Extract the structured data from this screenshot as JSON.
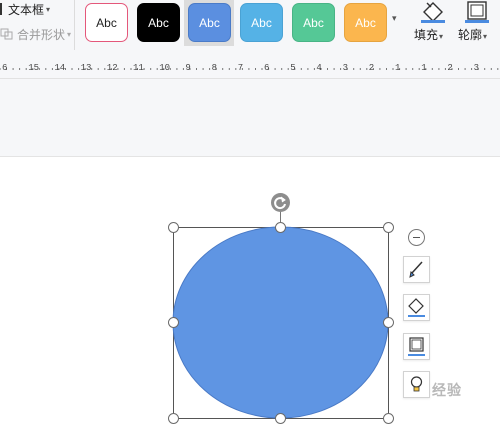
{
  "ribbon": {
    "text_box_label": "文本框",
    "merge_shapes_label": "合并形状",
    "dropdown_caret": "▾",
    "style_presets": [
      {
        "label": "Abc",
        "fill": "#ffffff",
        "border": "#e4577a",
        "text_color": "#222222"
      },
      {
        "label": "Abc",
        "fill": "#000000",
        "border": "#000000",
        "text_color": "#ffffff"
      },
      {
        "label": "Abc",
        "fill": "#5b8fe0",
        "border": "#4a7bc8",
        "text_color": "#ffffff"
      },
      {
        "label": "Abc",
        "fill": "#55b2e6",
        "border": "#4aa2d4",
        "text_color": "#ffffff"
      },
      {
        "label": "Abc",
        "fill": "#55c896",
        "border": "#48b486",
        "text_color": "#ffffff"
      },
      {
        "label": "Abc",
        "fill": "#fbb64e",
        "border": "#e6a440",
        "text_color": "#ffffff"
      }
    ],
    "more_styles_icon": "chevron-down-icon",
    "fill_label": "填充",
    "outline_label": "轮廓"
  },
  "ruler": {
    "labels": [
      "6",
      "15",
      "14",
      "13",
      "12",
      "11",
      "10",
      "9",
      "8",
      "7",
      "6",
      "5",
      "4",
      "3",
      "2",
      "1",
      "1",
      "2",
      "3"
    ]
  },
  "canvas": {
    "shape": "ellipse",
    "shape_fill": "#5f95e3",
    "shape_stroke": "#4a7ac6",
    "float_tools": [
      "brush-icon",
      "fill-bucket-icon",
      "outline-icon",
      "lightbulb-icon"
    ]
  },
  "watermark": "经验"
}
